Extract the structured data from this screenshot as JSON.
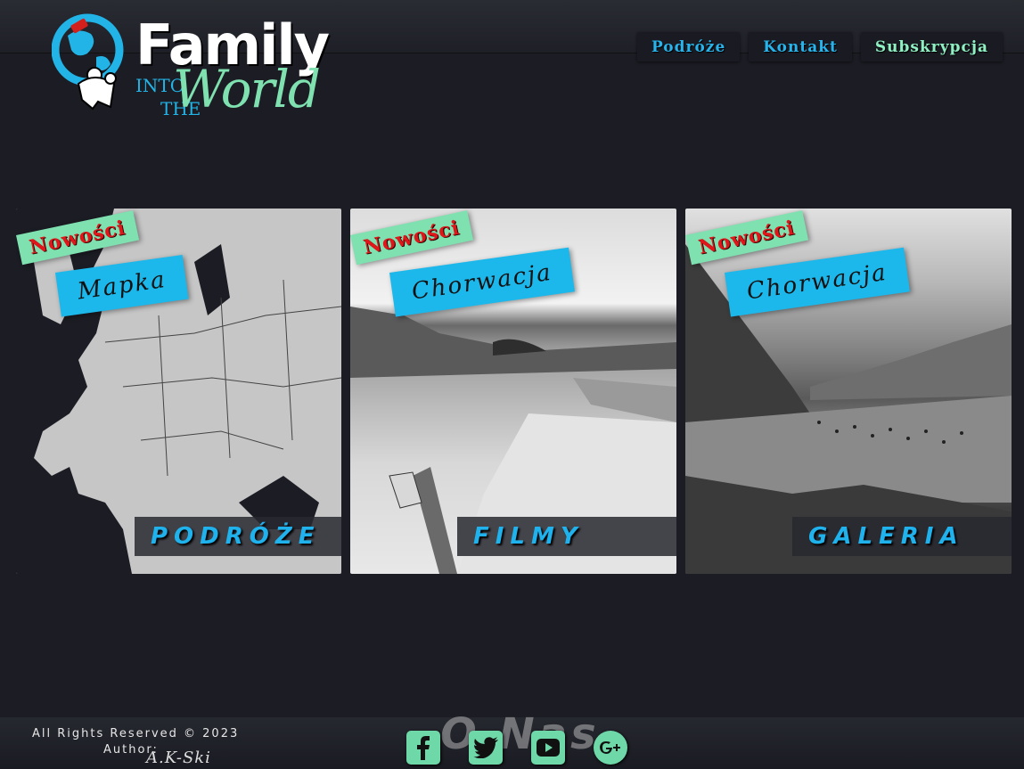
{
  "logo": {
    "title": "Family",
    "into": "INTO",
    "the": "THE",
    "world": "World"
  },
  "nav": {
    "items": [
      {
        "label": "Podróże",
        "color": "#27b4ec"
      },
      {
        "label": "Kontakt",
        "color": "#27b4ec"
      },
      {
        "label": "Subskrypcja",
        "color": "#8ff0c3"
      }
    ]
  },
  "cards": [
    {
      "news": "Nowości",
      "sub": "Mapka",
      "caption": "Podróże"
    },
    {
      "news": "Nowości",
      "sub": "Chorwacja",
      "caption": "Filmy"
    },
    {
      "news": "Nowości",
      "sub": "Chorwacja",
      "caption": "Galeria"
    }
  ],
  "footer": {
    "rights": "All Rights Reserved © 2023",
    "author_label": "Author:",
    "author_name": "A.K-Ski",
    "about": "O Nas",
    "socials": [
      "facebook-icon",
      "twitter-icon",
      "youtube-icon",
      "google-plus-icon"
    ]
  },
  "colors": {
    "accent_blue": "#1fb2ec",
    "accent_green": "#7fe0b0",
    "news_red": "#e0161a",
    "background": "#1c1c24"
  }
}
